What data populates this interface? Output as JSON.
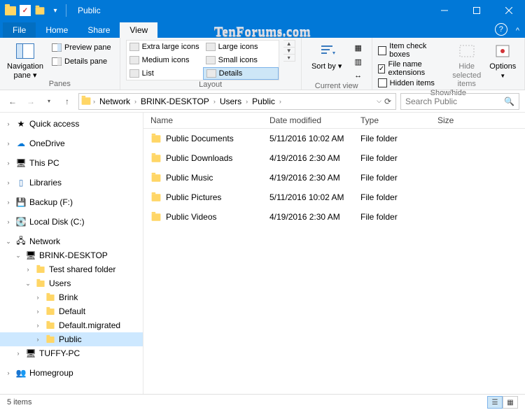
{
  "window": {
    "title": "Public"
  },
  "watermark": "TenForums.com",
  "tabs": {
    "file": "File",
    "home": "Home",
    "share": "Share",
    "view": "View"
  },
  "ribbon": {
    "panes": {
      "nav": "Navigation pane ▾",
      "preview": "Preview pane",
      "details": "Details pane",
      "label": "Panes"
    },
    "layout": {
      "items": [
        "Extra large icons",
        "Large icons",
        "Medium icons",
        "Small icons",
        "List",
        "Details"
      ],
      "label": "Layout"
    },
    "current": {
      "sort": "Sort by ▾",
      "label": "Current view"
    },
    "showhide": {
      "itemcheck": "Item check boxes",
      "ext": "File name extensions",
      "hidden": "Hidden items",
      "hidesel": "Hide selected items",
      "options": "Options",
      "label": "Show/hide"
    }
  },
  "breadcrumb": [
    "Network",
    "BRINK-DESKTOP",
    "Users",
    "Public"
  ],
  "search_placeholder": "Search Public",
  "tree": {
    "quick": "Quick access",
    "onedrive": "OneDrive",
    "thispc": "This PC",
    "libraries": "Libraries",
    "backup": "Backup (F:)",
    "localc": "Local Disk (C:)",
    "network": "Network",
    "brink": "BRINK-DESKTOP",
    "testshare": "Test shared folder",
    "users": "Users",
    "u_brink": "Brink",
    "u_default": "Default",
    "u_defaultm": "Default.migrated",
    "u_public": "Public",
    "tuffy": "TUFFY-PC",
    "homegroup": "Homegroup"
  },
  "columns": {
    "name": "Name",
    "date": "Date modified",
    "type": "Type",
    "size": "Size"
  },
  "files": [
    {
      "name": "Public Documents",
      "date": "5/11/2016 10:02 AM",
      "type": "File folder"
    },
    {
      "name": "Public Downloads",
      "date": "4/19/2016 2:30 AM",
      "type": "File folder"
    },
    {
      "name": "Public Music",
      "date": "4/19/2016 2:30 AM",
      "type": "File folder"
    },
    {
      "name": "Public Pictures",
      "date": "5/11/2016 10:02 AM",
      "type": "File folder"
    },
    {
      "name": "Public Videos",
      "date": "4/19/2016 2:30 AM",
      "type": "File folder"
    }
  ],
  "status": {
    "count": "5 items"
  }
}
